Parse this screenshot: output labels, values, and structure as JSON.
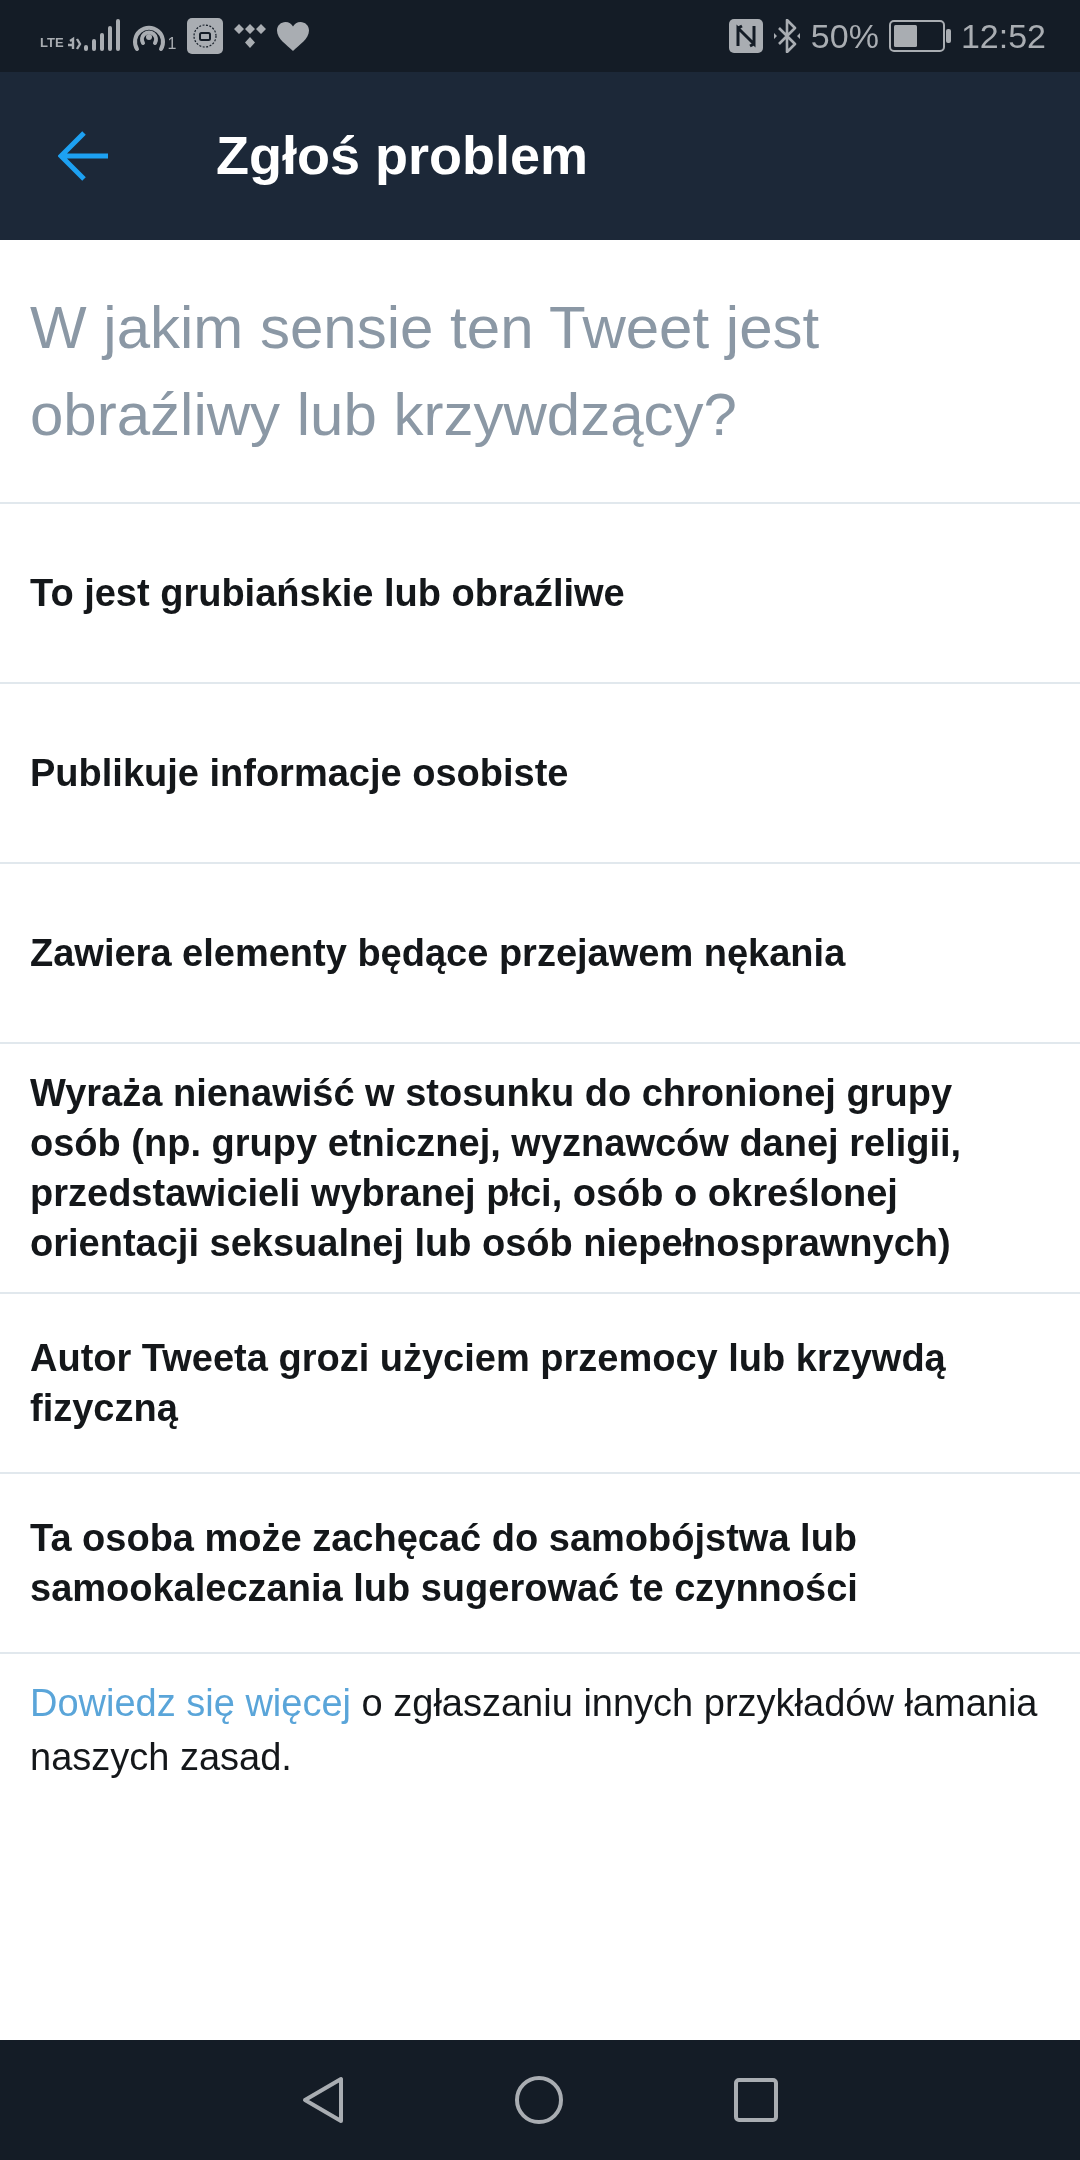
{
  "status_bar": {
    "network": "LTE",
    "hotspot_count": "1",
    "battery": "50%",
    "time": "12:52"
  },
  "header": {
    "title": "Zgłoś problem"
  },
  "question": "W jakim sensie ten Tweet jest obraźliwy lub krzywdzący?",
  "options": [
    {
      "label": "To jest grubiańskie lub obraźliwe"
    },
    {
      "label": "Publikuje informacje osobiste"
    },
    {
      "label": "Zawiera elementy będące przejawem nękania"
    },
    {
      "label": "Wyraża nienawiść w stosunku do chronionej grupy osób (np. grupy etnicznej, wyznawców danej religii, przedstawicieli wybranej płci, osób o określonej orientacji seksualnej lub osób niepełnosprawnych)"
    },
    {
      "label": "Autor Tweeta grozi użyciem przemocy lub krzywdą fizyczną"
    },
    {
      "label": "Ta osoba może zachęcać do samobójstwa lub samookaleczania lub sugerować te czynności"
    }
  ],
  "footer": {
    "link": "Dowiedz się więcej",
    "text": "o zgłaszaniu innych przykładów łamania naszych zasad."
  }
}
